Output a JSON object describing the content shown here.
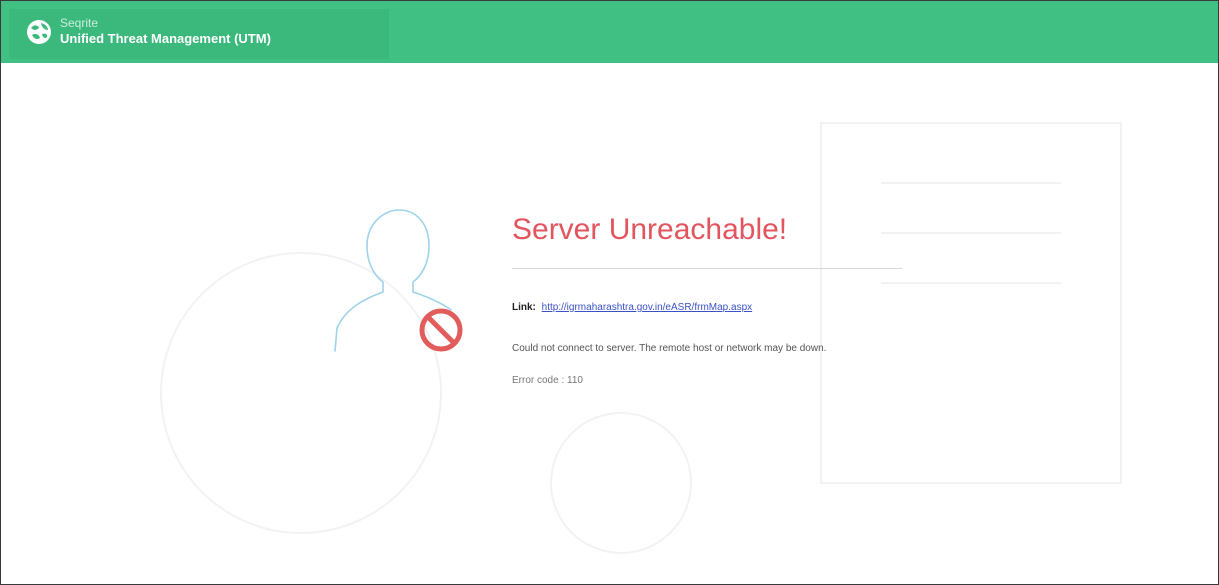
{
  "header": {
    "brand": "Seqrite",
    "product": "Unified Threat Management (UTM)",
    "icon": "seqrite-globe-logo"
  },
  "error": {
    "title": "Server Unreachable!",
    "link_label": "Link:",
    "link_url": "http://igrmaharashtra.gov.in/eASR/frmMap.aspx",
    "message": "Could not connect to server. The remote host or network may be down.",
    "error_code": "Error code : 110",
    "icon": "blocked-icon"
  },
  "colors": {
    "header_bg": "#41c083",
    "title": "#e2555f",
    "link": "#3a52c4",
    "illustration_outline": "#9fd3ea",
    "blocked_icon": "#e25c5c"
  }
}
